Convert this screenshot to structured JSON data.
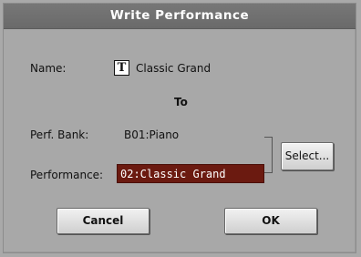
{
  "dialog": {
    "title": "Write Performance",
    "name_label": "Name:",
    "name_value": "Classic Grand",
    "text_edit_icon_glyph": "T",
    "to_label": "To",
    "perf_bank_label": "Perf. Bank:",
    "perf_bank_value": "B01:Piano",
    "performance_label": "Performance:",
    "performance_value": "02:Classic Grand",
    "select_label": "Select...",
    "cancel_label": "Cancel",
    "ok_label": "OK"
  },
  "colors": {
    "title_bar": "#6e6e6e",
    "dialog_bg": "#a8a8a8",
    "selected_field_bg": "#6b1a10",
    "selected_field_text": "#ffffff"
  }
}
